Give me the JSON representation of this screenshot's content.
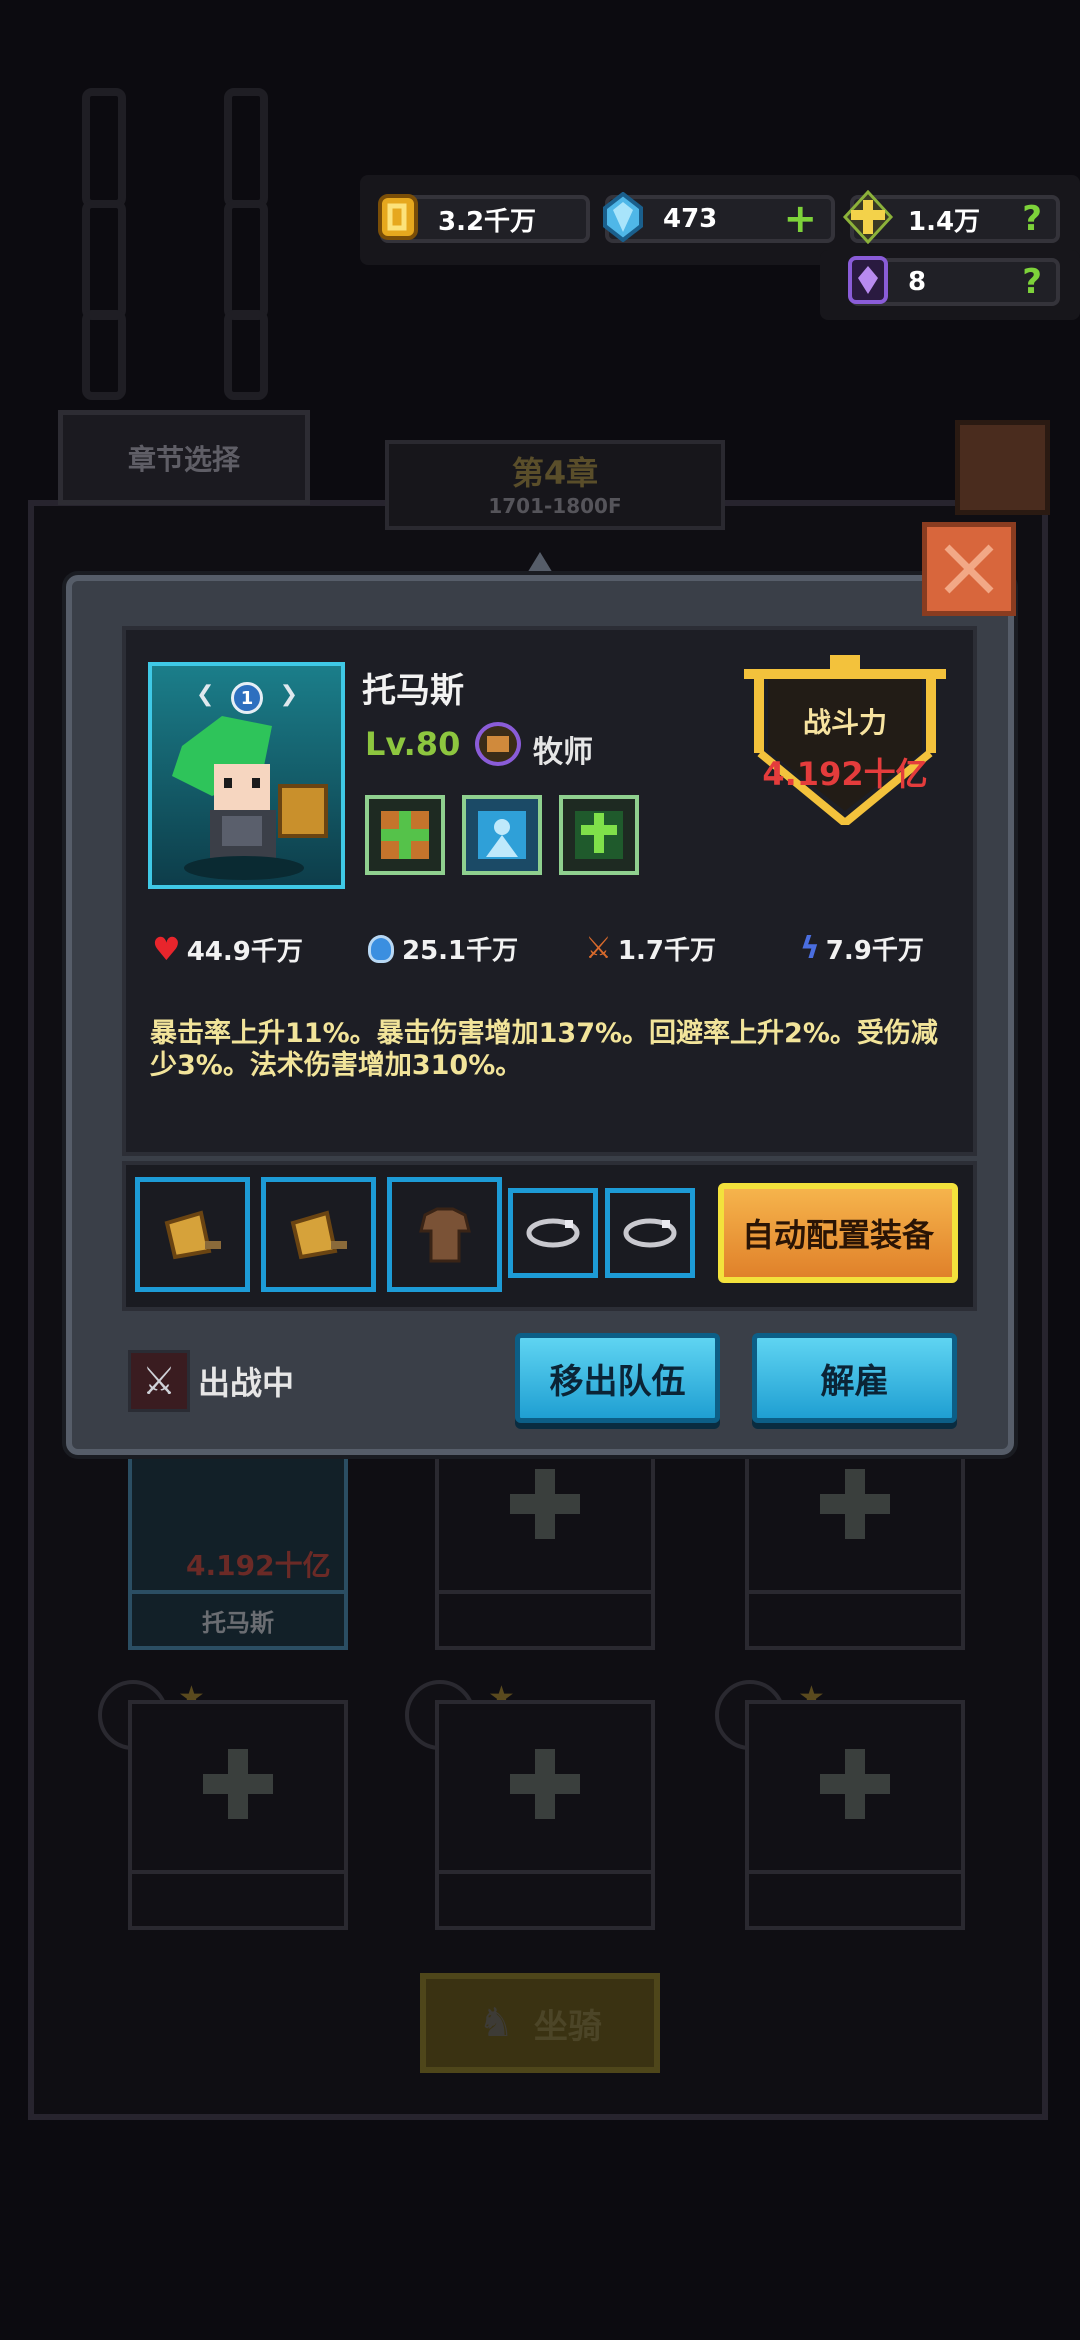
{
  "currency": {
    "gold": "3.2千万",
    "gem": "473",
    "gem_add": "+",
    "cross": "1.4万",
    "cross_help": "?",
    "crystal": "8",
    "crystal_help": "?"
  },
  "background": {
    "chapter_select": "章节选择",
    "chapter_title": "第4章",
    "chapter_range": "1701-1800F",
    "team_member_power": "4.192十亿",
    "team_member_name": "托马斯",
    "mount_button": "坐骑"
  },
  "hero": {
    "name": "托马斯",
    "level": "Lv.80",
    "class": "牧师",
    "rank": "1",
    "power_label": "战斗力",
    "power_value": "4.192十亿",
    "stats": {
      "hp": "44.9千万",
      "mp": "25.1千万",
      "attack": "1.7千万",
      "speed": "7.9千万"
    },
    "description": "暴击率上升11%。暴击伤害增加137%。回避率上升2%。受伤减少3%。法术伤害增加310%。"
  },
  "equipment": {
    "auto_equip": "自动配置装备"
  },
  "footer": {
    "status": "出战中",
    "remove_button": "移出队伍",
    "dismiss_button": "解雇"
  },
  "colors": {
    "accent_blue": "#1d9bd6",
    "power_red": "#e43c3c",
    "level_green": "#8dc63f",
    "gold": "#f3c23c"
  }
}
